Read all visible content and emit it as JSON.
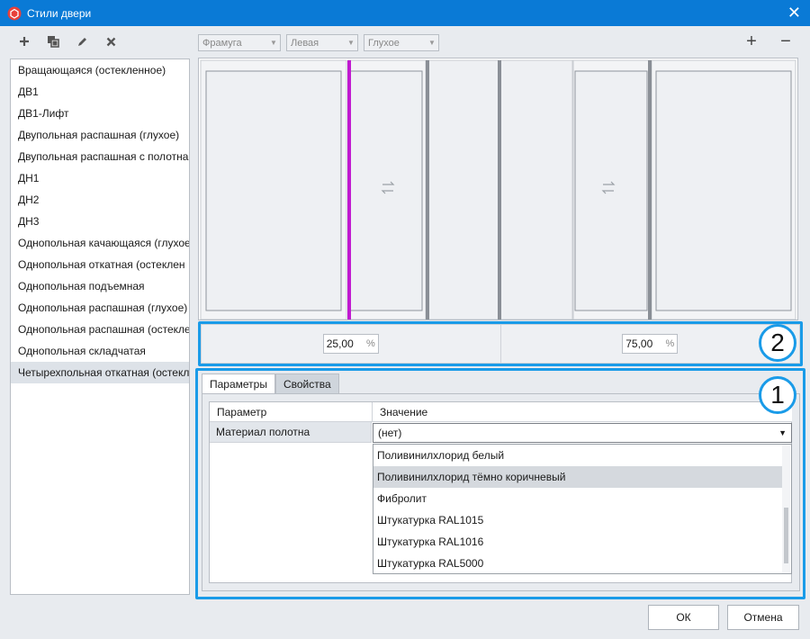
{
  "window": {
    "title": "Стили двери",
    "close_glyph": "✕"
  },
  "toolbar_left": [
    {
      "name": "add-icon",
      "glyph": "+"
    },
    {
      "name": "copy-icon",
      "glyph": "⧉"
    },
    {
      "name": "edit-icon",
      "glyph": "✎"
    },
    {
      "name": "delete-icon",
      "glyph": "✖"
    }
  ],
  "styles_list": {
    "items": [
      "Вращающаяся (остекленное)",
      "ДВ1",
      "ДВ1-Лифт",
      "Двупольная распашная (глухое)",
      "Двупольная распашная с полотна",
      "ДН1",
      "ДН2",
      "ДН3",
      "Однопольная качающаяся (глухое",
      "Однопольная откатная (остеклен",
      "Однопольная подъемная",
      "Однопольная распашная (глухое)",
      "Однопольная распашная (остекле",
      "Однопольная складчатая",
      "Четырехпольная откатная (остекле"
    ],
    "selected_index": 14
  },
  "combos": {
    "type": "Фрамуга",
    "side": "Левая",
    "fill": "Глухое"
  },
  "toolbar_right": {
    "add_glyph": "+",
    "remove_glyph": "−"
  },
  "ratios": {
    "left_value": "25,00",
    "right_value": "75,00",
    "unit": "%"
  },
  "badges": {
    "ratios": "2",
    "params": "1"
  },
  "tabs": {
    "params": "Параметры",
    "properties": "Свойства"
  },
  "grid": {
    "header_param": "Параметр",
    "header_value": "Значение",
    "row_param": "Материал полотна",
    "row_value": "(нет)"
  },
  "dropdown": {
    "options": [
      "Поливинилхлорид белый",
      "Поливинилхлорид тёмно коричневый",
      "Фибролит",
      "Штукатурка RAL1015",
      "Штукатурка RAL1016",
      "Штукатурка RAL5000"
    ],
    "highlighted_index": 1
  },
  "buttons": {
    "ok": "ОК",
    "cancel": "Отмена"
  },
  "colors": {
    "titlebar": "#0a7ad6",
    "accent": "#1a9be8",
    "divider_highlight": "#c01ad0"
  }
}
